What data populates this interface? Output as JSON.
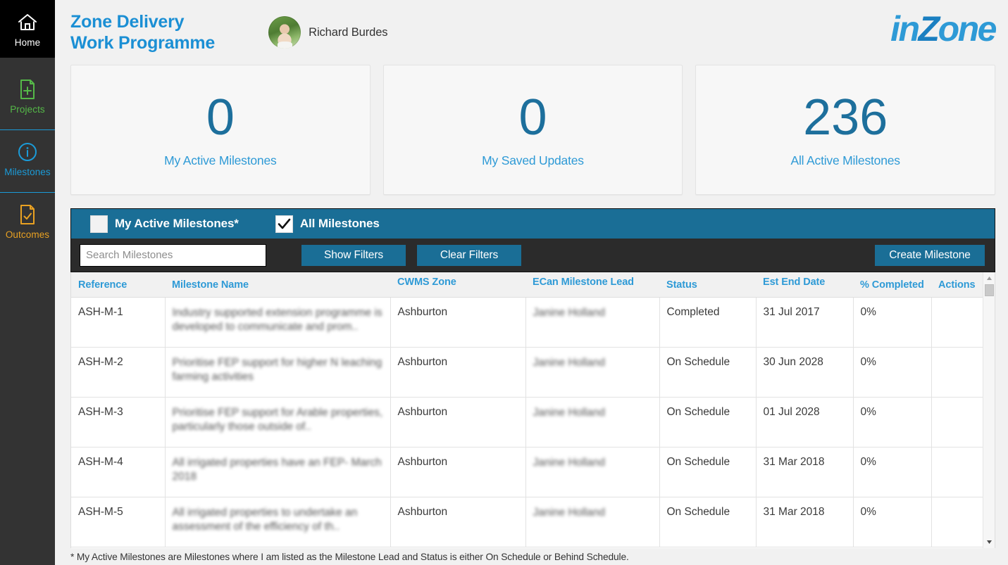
{
  "sidebar": {
    "items": [
      {
        "label": "Home",
        "icon": "home-icon",
        "color": "#ffffff",
        "active": true
      },
      {
        "label": "Projects",
        "icon": "document-plus-icon",
        "color": "#55b948",
        "active": false
      },
      {
        "label": "Milestones",
        "icon": "info-circle-icon",
        "color": "#1b9bd8",
        "active": false
      },
      {
        "label": "Outcomes",
        "icon": "document-check-icon",
        "color": "#e9a122",
        "active": false
      }
    ]
  },
  "header": {
    "title": "Zone Delivery\nWork Programme",
    "user_name": "Richard Burdes",
    "logo_pre": "in",
    "logo_cap": "Z",
    "logo_post": "one"
  },
  "cards": [
    {
      "value": "0",
      "label": "My Active Milestones"
    },
    {
      "value": "0",
      "label": "My Saved Updates"
    },
    {
      "value": "236",
      "label": "All Active Milestones"
    }
  ],
  "filters": {
    "my_active_label": "My Active Milestones*",
    "my_active_checked": false,
    "all_label": "All Milestones",
    "all_checked": true,
    "search_placeholder": "Search Milestones",
    "search_value": "",
    "show_filters_label": "Show Filters",
    "clear_filters_label": "Clear Filters",
    "create_milestone_label": "Create Milestone"
  },
  "table": {
    "columns": [
      "Reference",
      "Milestone Name",
      "CWMS Zone",
      "ECan Milestone Lead",
      "Status",
      "Est End Date",
      "% Completed",
      "Actions"
    ],
    "rows": [
      {
        "reference": "ASH-M-1",
        "name": "Industry supported extension programme is developed to communicate and prom..",
        "zone": "Ashburton",
        "lead": "Janine Holland",
        "status": "Completed",
        "est_end_date": "31 Jul 2017",
        "percent_completed": "0%",
        "actions": ""
      },
      {
        "reference": "ASH-M-2",
        "name": "Prioritise FEP support for higher N leaching farming activities",
        "zone": "Ashburton",
        "lead": "Janine Holland",
        "status": "On Schedule",
        "est_end_date": "30 Jun 2028",
        "percent_completed": "0%",
        "actions": ""
      },
      {
        "reference": "ASH-M-3",
        "name": "Prioritise FEP support for Arable properties, particularly those outside of..",
        "zone": "Ashburton",
        "lead": "Janine Holland",
        "status": "On Schedule",
        "est_end_date": "01 Jul 2028",
        "percent_completed": "0%",
        "actions": ""
      },
      {
        "reference": "ASH-M-4",
        "name": "All irrigated properties have an FEP- March 2018",
        "zone": "Ashburton",
        "lead": "Janine Holland",
        "status": "On Schedule",
        "est_end_date": "31 Mar 2018",
        "percent_completed": "0%",
        "actions": ""
      },
      {
        "reference": "ASH-M-5",
        "name": "All irrigated properties to undertake an assessment of the efficiency of th..",
        "zone": "Ashburton",
        "lead": "Janine Holland",
        "status": "On Schedule",
        "est_end_date": "31 Mar 2018",
        "percent_completed": "0%",
        "actions": ""
      }
    ]
  },
  "footnote": "* My Active Milestones are Milestones where I am listed as the Milestone Lead and Status is either On Schedule or Behind Schedule.",
  "colors": {
    "accent_blue": "#2e9ad6",
    "panel_blue": "#1a6e96",
    "sidebar_dark": "#333333",
    "home_black": "#000000",
    "green": "#55b948",
    "orange": "#e9a122"
  }
}
